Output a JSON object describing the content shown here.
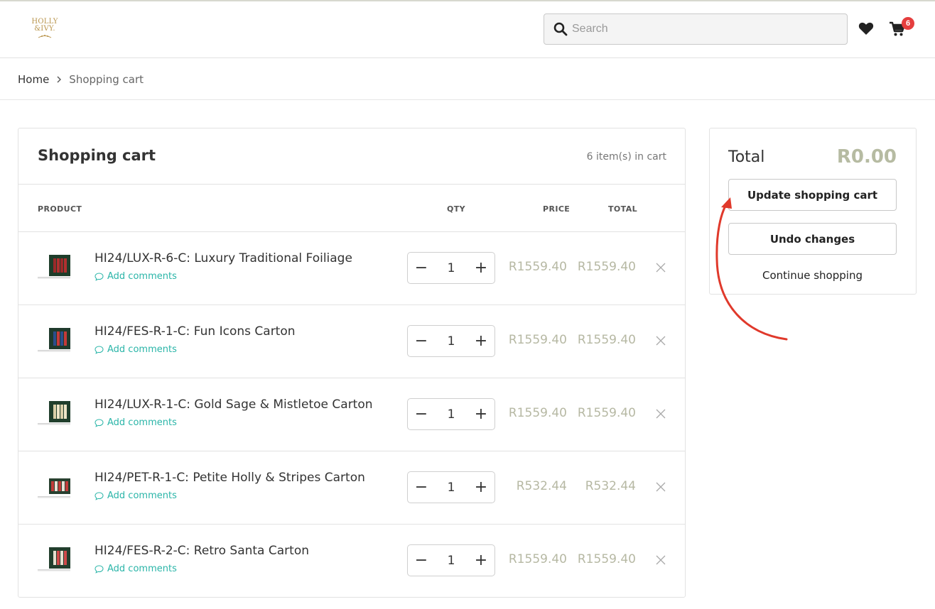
{
  "header": {
    "logo_line1": "HOLLY",
    "logo_line2": "&IVY.",
    "search_placeholder": "Search",
    "cart_badge": "6",
    "icons": [
      "search-icon",
      "heart-icon",
      "cart-icon"
    ]
  },
  "breadcrumb": {
    "home": "Home",
    "current": "Shopping cart"
  },
  "cart": {
    "title": "Shopping cart",
    "count_text": "6 item(s) in cart",
    "columns": {
      "product": "PRODUCT",
      "qty": "QTY",
      "price": "PRICE",
      "total": "TOTAL"
    },
    "comments_label": "Add comments",
    "items": [
      {
        "name": "HI24/LUX-R-6-C: Luxury Traditional Foiliage",
        "qty": "1",
        "price": "R1559.40",
        "total": "R1559.40"
      },
      {
        "name": "HI24/FES-R-1-C: Fun Icons Carton",
        "qty": "1",
        "price": "R1559.40",
        "total": "R1559.40"
      },
      {
        "name": "HI24/LUX-R-1-C: Gold Sage & Mistletoe Carton",
        "qty": "1",
        "price": "R1559.40",
        "total": "R1559.40"
      },
      {
        "name": "HI24/PET-R-1-C: Petite Holly & Stripes Carton",
        "qty": "1",
        "price": "R532.44",
        "total": "R532.44"
      },
      {
        "name": "HI24/FES-R-2-C: Retro Santa Carton",
        "qty": "1",
        "price": "R1559.40",
        "total": "R1559.40"
      }
    ]
  },
  "summary": {
    "total_label": "Total",
    "total_value": "R0.00",
    "update_label": "Update shopping cart",
    "undo_label": "Undo changes",
    "continue_label": "Continue shopping"
  },
  "colors": {
    "accent_teal": "#2ab5a8",
    "price_muted": "#b6b8a3",
    "badge_red": "#e53e3e",
    "annotation_red": "#e0392b",
    "logo_gold": "#b8944b"
  }
}
